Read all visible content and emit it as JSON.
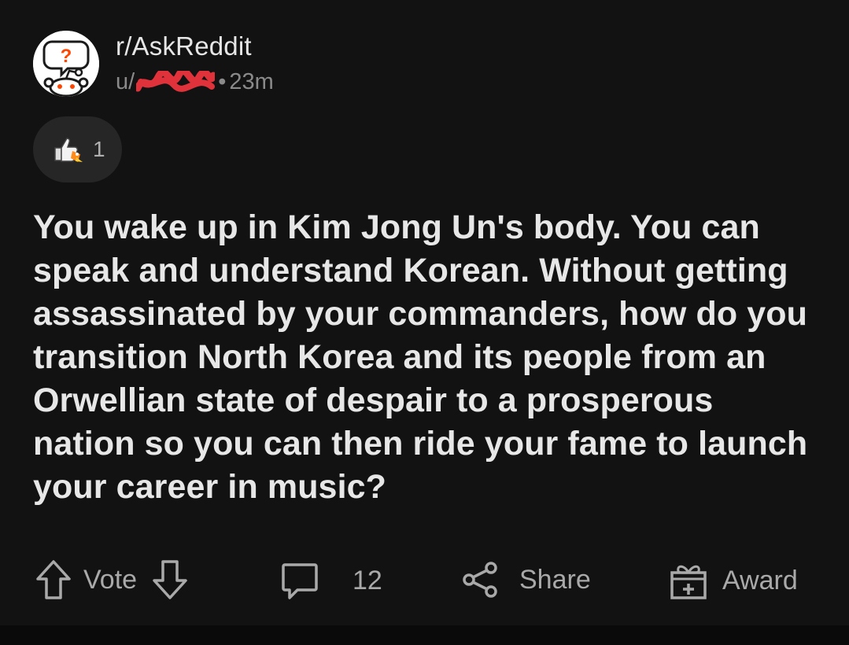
{
  "header": {
    "subreddit": "r/AskReddit",
    "user_prefix": "u/",
    "separator": "•",
    "time": "23m"
  },
  "awards": {
    "count": "1",
    "icon": "thumbs-up-rocket-award-icon"
  },
  "post": {
    "title": "You wake up in Kim Jong Un's body. You can speak and understand Korean. Without getting assassinated by your commanders, how do you transition North Korea and its people from an Orwellian state of despair to a prosperous nation so you can then ride your fame to launch your career in music?"
  },
  "actions": {
    "vote_label": "Vote",
    "comments_count": "12",
    "share_label": "Share",
    "award_label": "Award"
  },
  "colors": {
    "background": "#121212",
    "text": "#e7e7e7",
    "muted": "#8a8a8a",
    "redaction": "#e0323a"
  }
}
